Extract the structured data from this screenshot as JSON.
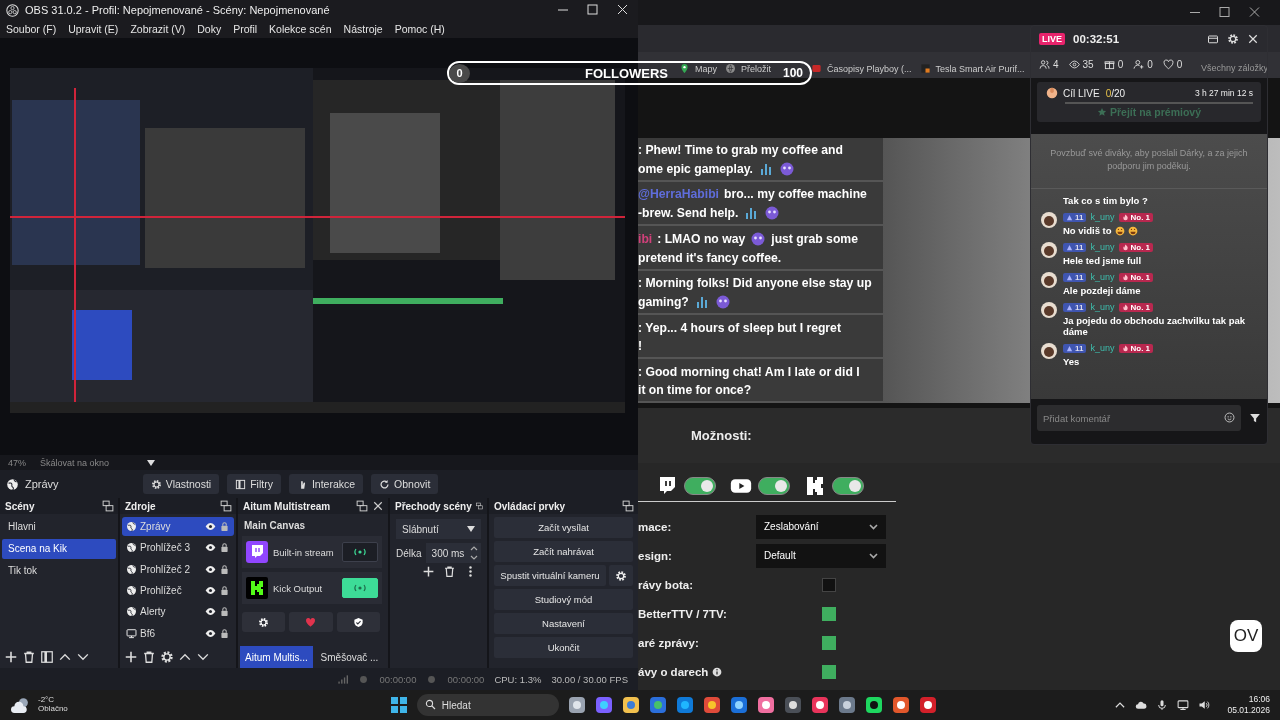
{
  "obs": {
    "title": "OBS 31.0.2 - Profil: Nepojmenované - Scény: Nepojmenované",
    "menu": [
      "Soubor (F)",
      "Upravit (E)",
      "Zobrazit (V)",
      "Doky",
      "Profil",
      "Kolekce scén",
      "Nástroje",
      "Pomoc (H)"
    ],
    "zoom": "47%",
    "scale_mode": "Škálovat na okno",
    "source_bar": {
      "source": "Zprávy",
      "buttons": [
        {
          "kind": "properties",
          "label": "Vlastnosti"
        },
        {
          "kind": "filters",
          "label": "Filtry"
        },
        {
          "kind": "interact",
          "label": "Interakce"
        },
        {
          "kind": "refresh",
          "label": "Obnovit"
        }
      ]
    },
    "scenes": {
      "title": "Scény",
      "items": [
        {
          "label": "Hlavni",
          "selected": false
        },
        {
          "label": "Scena na Kik",
          "selected": true
        },
        {
          "label": "Tik tok",
          "selected": false
        }
      ]
    },
    "sources": {
      "title": "Zdroje",
      "items": [
        {
          "kind": "browser",
          "label": "Zprávy",
          "selected": true
        },
        {
          "kind": "browser",
          "label": "Prohlížeč 3",
          "selected": false
        },
        {
          "kind": "browser",
          "label": "Prohlížeč 2",
          "selected": false
        },
        {
          "kind": "browser",
          "label": "Prohlížeč",
          "selected": false
        },
        {
          "kind": "browser",
          "label": "Alerty",
          "selected": false
        },
        {
          "kind": "display",
          "label": "Bf6",
          "selected": false
        }
      ]
    },
    "aitum": {
      "title": "Aitum Multistream",
      "canvas": "Main Canvas",
      "outputs": [
        {
          "kind": "twitch",
          "label": "Built-in stream",
          "on": false
        },
        {
          "kind": "kick",
          "label": "Kick Output",
          "on": true
        }
      ],
      "tabs": [
        {
          "label": "Aitum Multis...",
          "selected": true
        },
        {
          "label": "Směšovač ...",
          "selected": false
        }
      ]
    },
    "transitions": {
      "title": "Přechody scény",
      "type": "Slábnutí",
      "duration_label": "Délka",
      "duration": "300 ms"
    },
    "controls": {
      "title": "Ovládací prvky",
      "buttons": [
        {
          "label": "Začít vysílat",
          "has_settings": false
        },
        {
          "label": "Začít nahrávat",
          "has_settings": false
        },
        {
          "label": "Spustit virtuální kameru",
          "has_settings": true
        },
        {
          "label": "Studiový mód",
          "has_settings": false
        },
        {
          "label": "Nastavení",
          "has_settings": false
        },
        {
          "label": "Ukončit",
          "has_settings": false
        }
      ]
    },
    "status": {
      "stream_time": "00:00:00",
      "rec_time": "00:00:00",
      "cpu": "CPU: 1.3%",
      "fps": "30.00 / 30.00 FPS"
    }
  },
  "followers_bar": {
    "current": "0",
    "label": "FOLLOWERS",
    "goal": "100"
  },
  "browser": {
    "bookmarks": [
      {
        "kind": "maps",
        "label": "Mapy"
      },
      {
        "kind": "translate",
        "label": "Přeložit"
      },
      {
        "kind": "page",
        "label": "Časopisy Playboy (..."
      },
      {
        "kind": "brand",
        "label": "Tesla Smart Air Purif..."
      }
    ],
    "all_bookmarks": "Všechny záložky",
    "chat_overlay": [
      {
        "lines": [
          [
            {
              "kind": "text",
              "text": ": Phew! Time to grab my coffee and"
            }
          ],
          [
            {
              "kind": "text",
              "text": "ome epic gameplay."
            },
            {
              "kind": "emote"
            },
            {
              "kind": "emote"
            }
          ]
        ]
      },
      {
        "lines": [
          [
            {
              "kind": "mention",
              "text": "@HerraHabibi"
            },
            {
              "kind": "text",
              "text": "bro... my coffee machine"
            }
          ],
          [
            {
              "kind": "text",
              "text": "-brew. Send help."
            },
            {
              "kind": "emote"
            },
            {
              "kind": "emote"
            }
          ]
        ]
      },
      {
        "lines": [
          [
            {
              "kind": "user",
              "text": "ibi"
            },
            {
              "kind": "text",
              "text": ": LMAO no way"
            },
            {
              "kind": "emote"
            },
            {
              "kind": "text",
              "text": "just grab some"
            }
          ],
          [
            {
              "kind": "text",
              "text": "pretend it's fancy coffee."
            }
          ]
        ]
      },
      {
        "lines": [
          [
            {
              "kind": "text",
              "text": ": Morning folks! Did anyone else stay up"
            }
          ],
          [
            {
              "kind": "text",
              "text": "gaming?"
            },
            {
              "kind": "emote"
            },
            {
              "kind": "emote"
            }
          ]
        ]
      },
      {
        "lines": [
          [
            {
              "kind": "text",
              "text": ": Yep... 4 hours of sleep but I regret"
            }
          ],
          [
            {
              "kind": "text",
              "text": "!"
            }
          ]
        ]
      },
      {
        "lines": [
          [
            {
              "kind": "text",
              "text": ": Good morning chat! Am I late or did I"
            }
          ],
          [
            {
              "kind": "text",
              "text": "it on time for once?"
            }
          ]
        ]
      }
    ],
    "options_title": "Možnosti:",
    "platforms": [
      {
        "kind": "twitch",
        "on": true
      },
      {
        "kind": "youtube",
        "on": true
      },
      {
        "kind": "kick",
        "on": true
      }
    ],
    "settings": [
      {
        "kind": "select",
        "label": "mace:",
        "value": "Zeslabování"
      },
      {
        "kind": "select",
        "label": "esign:",
        "value": "Default"
      },
      {
        "kind": "checkbox",
        "label": "rávy bota:",
        "checked": false,
        "info": false
      },
      {
        "kind": "checkbox",
        "label": "BetterTTV / 7TV:",
        "checked": true,
        "info": false
      },
      {
        "kind": "checkbox",
        "label": "aré zprávy:",
        "checked": true,
        "info": false
      },
      {
        "kind": "checkbox",
        "label": "ávy o darech",
        "checked": true,
        "info": true
      }
    ],
    "logo": "OV"
  },
  "tiktok_panel": {
    "live": "LIVE",
    "timer": "00:32:51",
    "stats": [
      {
        "kind": "people",
        "value": "4"
      },
      {
        "kind": "views",
        "value": "35"
      },
      {
        "kind": "gifts",
        "value": "0"
      },
      {
        "kind": "follows",
        "value": "0"
      },
      {
        "kind": "likes",
        "value": "0"
      }
    ],
    "goal": {
      "label": "Cíl LIVE",
      "current": "0",
      "total": "/20",
      "remaining": "3 h 27 min 12 s",
      "level": 0,
      "premium": "Přejít na prémiový"
    },
    "tip": "Povzbuď své diváky, aby poslali Dárky, a za jejich podporu jim poděkuj.",
    "messages": [
      {
        "kind": "continuation",
        "text": "Tak co s tim bylo ?"
      },
      {
        "kind": "full",
        "rank": "11",
        "user": "k_uny",
        "top": "No. 1",
        "text": "No vidiš to",
        "emojis": [
          {
            "kind": "grin"
          },
          {
            "kind": "grin"
          }
        ]
      },
      {
        "kind": "full",
        "rank": "11",
        "user": "k_uny",
        "top": "No. 1",
        "text": "Hele ted jsme full"
      },
      {
        "kind": "full",
        "rank": "11",
        "user": "k_uny",
        "top": "No. 1",
        "text": "Ale pozdeji dáme"
      },
      {
        "kind": "full",
        "rank": "11",
        "user": "k_uny",
        "top": "No. 1",
        "text": "Ja pojedu do obchodu zachvilku tak pak dáme"
      },
      {
        "kind": "full",
        "rank": "11",
        "user": "k_uny",
        "top": "No. 1",
        "text": "Yes"
      }
    ],
    "comment": {
      "placeholder": "Přidat komentář"
    }
  },
  "taskbar": {
    "temperature": "-2°C",
    "weather": "Oblačno",
    "search": {
      "placeholder": "Hledat"
    },
    "time": "16:06",
    "date": "05.01.2026"
  }
}
